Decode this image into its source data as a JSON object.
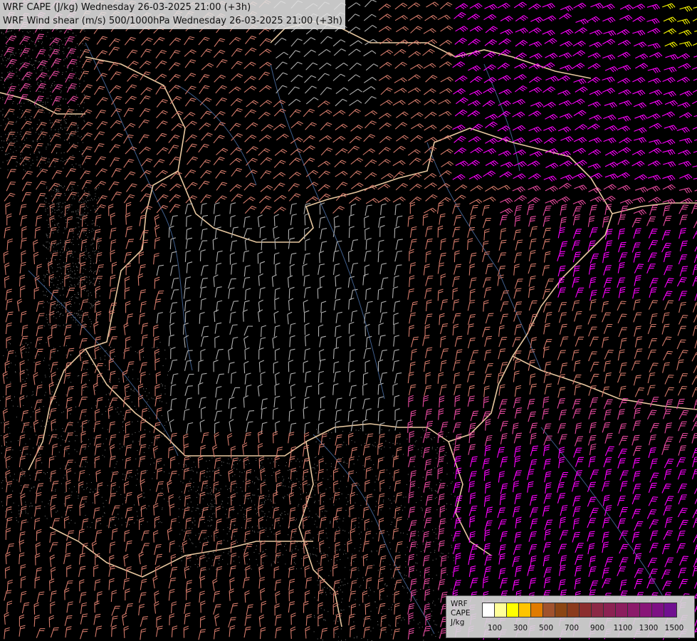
{
  "title": {
    "line1": "WRF CAPE (J/kg) Wednesday 26-03-2025 21:00 (+3h)",
    "line2": "WRF Wind shear (m/s) 500/1000hPa Wednesday 26-03-2025 21:00 (+3h)"
  },
  "legend": {
    "label_lines": [
      "WRF",
      "CAPE",
      "J/kg"
    ],
    "swatches": [
      "#ffffff",
      "#ffff99",
      "#ffff00",
      "#ffc400",
      "#e07b00",
      "#a0522d",
      "#8b4513",
      "#8b3a1c",
      "#8b2e2e",
      "#8b2845",
      "#8b2252",
      "#8b1d5e",
      "#8b1a6a",
      "#881578",
      "#7d1084",
      "#701090"
    ],
    "ticks": [
      "100",
      "300",
      "500",
      "700",
      "900",
      "1100",
      "1300",
      "1500"
    ]
  },
  "colors": {
    "background": "#000000",
    "borders": "#e8c8a0",
    "rivers": "#4a6fa5",
    "barb_low": "#b0b0b0",
    "barb_mid": "#d47a6a",
    "barb_high": "#e84aa0",
    "barb_max": "#ff00ff",
    "barb_extreme": "#ffff00"
  }
}
